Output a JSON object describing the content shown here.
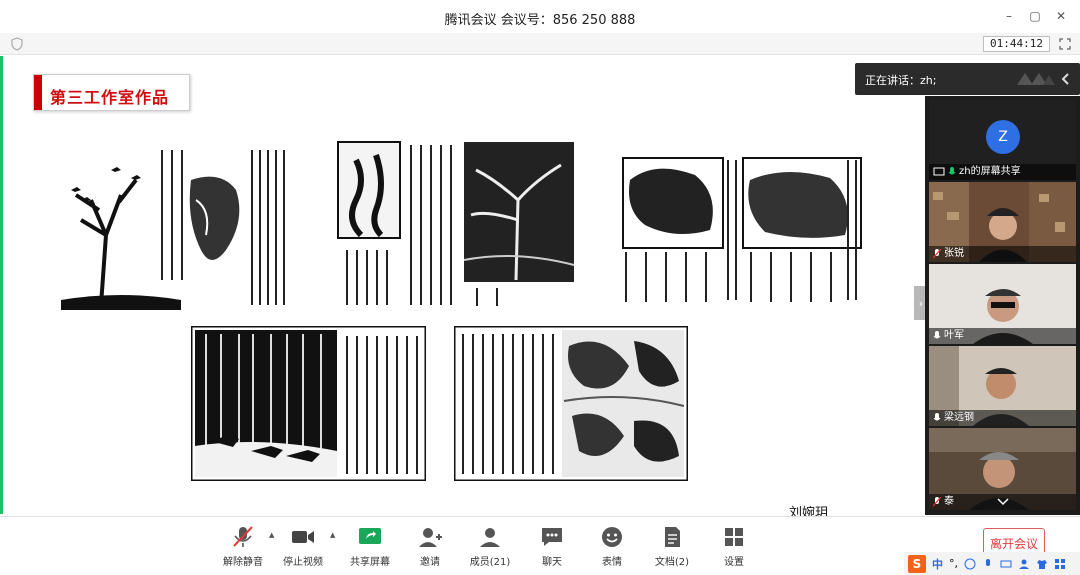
{
  "window": {
    "title": "腾讯会议 会议号：856 250 888"
  },
  "window_controls": {
    "minimize": "–",
    "maximize": "▢",
    "close": "✕"
  },
  "subbar": {
    "timer": "01:44:12"
  },
  "shared": {
    "slide_title": "第三工作室作品",
    "author": "刘婉玥"
  },
  "speaking": {
    "label": "正在讲话：zh;"
  },
  "participants": [
    {
      "name": "zh的屏幕共享",
      "avatar_letter": "Z",
      "type": "screen"
    },
    {
      "name": "张锐",
      "type": "video"
    },
    {
      "name": "叶军",
      "type": "video"
    },
    {
      "name": "梁远钢",
      "type": "video"
    },
    {
      "name": "泰",
      "type": "video"
    }
  ],
  "toolbar": {
    "items": [
      {
        "label": "解除静音",
        "icon": "mic-muted-icon"
      },
      {
        "label": "停止视频",
        "icon": "camera-icon"
      },
      {
        "label": "共享屏幕",
        "icon": "share-screen-icon"
      },
      {
        "label": "邀请",
        "icon": "invite-icon"
      },
      {
        "label": "成员(21)",
        "icon": "members-icon"
      },
      {
        "label": "聊天",
        "icon": "chat-icon"
      },
      {
        "label": "表情",
        "icon": "emoji-icon"
      },
      {
        "label": "文档(2)",
        "icon": "document-icon"
      },
      {
        "label": "设置",
        "icon": "settings-icon"
      }
    ],
    "end_label": "离开会议"
  },
  "ime": {
    "logo": "S",
    "lang": "中",
    "punct": "°,"
  },
  "colors": {
    "accent_green": "#19c26b",
    "title_red": "#d01010",
    "end_red": "#e03a3a",
    "panel_bg": "#1c1c1c"
  }
}
